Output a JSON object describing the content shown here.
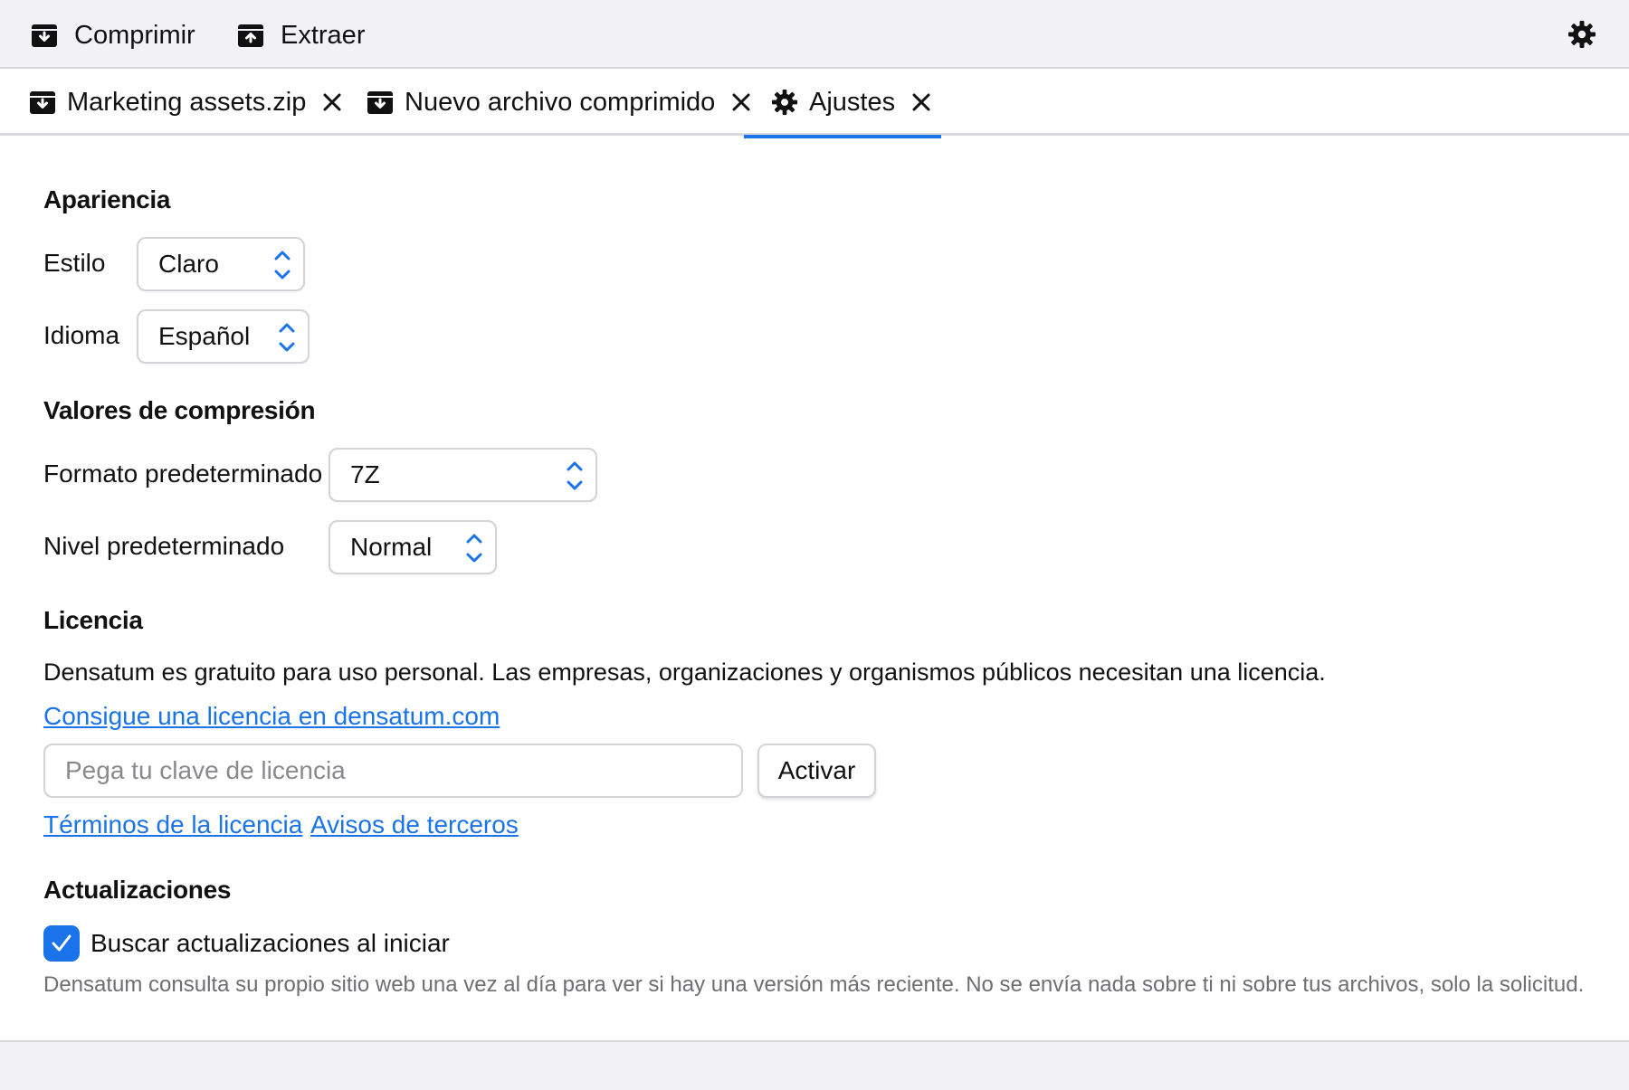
{
  "toolbar": {
    "compress_label": "Comprimir",
    "extract_label": "Extraer"
  },
  "tabs": [
    {
      "label": "Marketing assets.zip",
      "icon": "archive-icon"
    },
    {
      "label": "Nuevo archivo comprimido",
      "icon": "archive-icon"
    },
    {
      "label": "Ajustes",
      "icon": "gear-icon",
      "active": true
    }
  ],
  "appearance": {
    "heading": "Apariencia",
    "style_label": "Estilo",
    "style_value": "Claro",
    "language_label": "Idioma",
    "language_value": "Español"
  },
  "compression": {
    "heading": "Valores de compresión",
    "format_label": "Formato predeterminado",
    "format_value": "7Z",
    "level_label": "Nivel predeterminado",
    "level_value": "Normal"
  },
  "license": {
    "heading": "Licencia",
    "description": "Densatum es gratuito para uso personal. Las empresas, organizaciones y organismos públicos necesitan una licencia.",
    "get_link": "Consigue una licencia en densatum.com",
    "key_placeholder": "Pega tu clave de licencia",
    "key_value": "",
    "activate_label": "Activar",
    "terms_link": "Términos de la licencia",
    "notices_link": "Avisos de terceros"
  },
  "updates": {
    "heading": "Actualizaciones",
    "check_label": "Buscar actualizaciones al iniciar",
    "checked": true,
    "note": "Densatum consulta su propio sitio web una vez al día para ver si hay una versión más reciente. No se envía nada sobre ti ni sobre tus archivos, solo la solicitud."
  },
  "colors": {
    "accent": "#1a73e8",
    "toolbar_bg": "#f2f2f6",
    "muted_text": "#6e6e73"
  }
}
